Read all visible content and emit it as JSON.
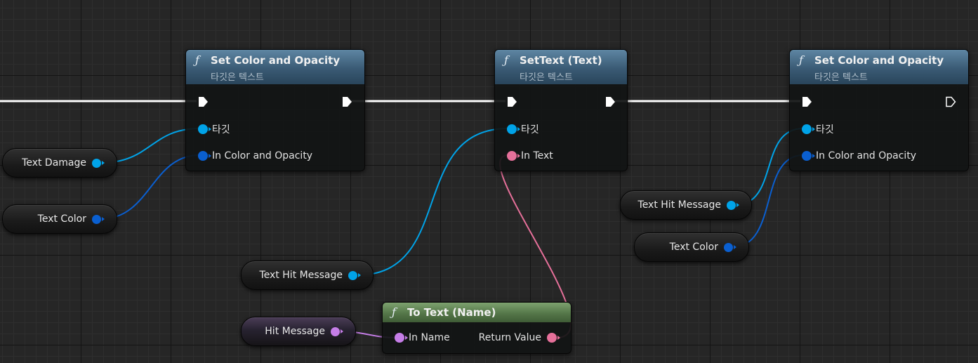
{
  "colors": {
    "exec": "#ffffff",
    "object": "#00a3e8",
    "struct": "#0a5fd0",
    "text": "#e6709a",
    "name": "#c67ee8"
  },
  "nodes": [
    {
      "id": "set_color_1",
      "icon": "function-icon",
      "title": "Set Color and Opacity",
      "subtitle": "타깃은 텍스트",
      "pins": {
        "target": "타깃",
        "in_color": "In Color and Opacity"
      }
    },
    {
      "id": "set_text",
      "icon": "function-icon",
      "title": "SetText (Text)",
      "subtitle": "타깃은 텍스트",
      "pins": {
        "target": "타깃",
        "in_text": "In Text"
      }
    },
    {
      "id": "set_color_2",
      "icon": "function-icon",
      "title": "Set Color and Opacity",
      "subtitle": "타깃은 텍스트",
      "pins": {
        "target": "타깃",
        "in_color": "In Color and Opacity"
      }
    },
    {
      "id": "to_text",
      "icon": "function-icon",
      "title": "To Text (Name)",
      "pins": {
        "in_name": "In Name",
        "return_value": "Return Value"
      }
    }
  ],
  "variables": [
    {
      "id": "text_damage",
      "label": "Text Damage"
    },
    {
      "id": "text_color_1",
      "label": "Text Color"
    },
    {
      "id": "text_hit_message_1",
      "label": "Text Hit Message"
    },
    {
      "id": "hit_message",
      "label": "Hit Message"
    },
    {
      "id": "text_hit_message_2",
      "label": "Text Hit Message"
    },
    {
      "id": "text_color_2",
      "label": "Text Color"
    }
  ]
}
